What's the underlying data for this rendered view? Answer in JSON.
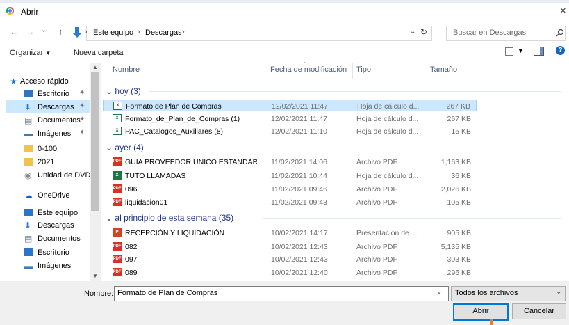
{
  "window": {
    "title": "Abrir",
    "close_glyph": "×"
  },
  "nav": {
    "back": "←",
    "forward": "→",
    "recent": "⌄",
    "up": "↑",
    "breadcrumbs": [
      "Este equipo",
      "Descargas"
    ],
    "search_placeholder": "Buscar en Descargas"
  },
  "toolbar": {
    "organize": "Organizar",
    "new_folder": "Nueva carpeta"
  },
  "sidebar": {
    "items": [
      {
        "label": "Acceso rápido",
        "icon": "star-icon"
      },
      {
        "label": "Escritorio",
        "icon": "desktop-icon",
        "pinned": true
      },
      {
        "label": "Descargas",
        "icon": "download-icon",
        "pinned": true,
        "selected": true
      },
      {
        "label": "Documentos",
        "icon": "document-icon",
        "pinned": true
      },
      {
        "label": "Imágenes",
        "icon": "pictures-icon",
        "pinned": true
      },
      {
        "label": "0-100",
        "icon": "folder-icon"
      },
      {
        "label": "2021",
        "icon": "folder-icon"
      },
      {
        "label": "Unidad de DVD R",
        "icon": "dvd-icon"
      },
      {
        "label": "OneDrive",
        "icon": "cloud-icon"
      },
      {
        "label": "Este equipo",
        "icon": "computer-icon"
      },
      {
        "label": "Descargas",
        "icon": "download-icon"
      },
      {
        "label": "Documentos",
        "icon": "document-icon"
      },
      {
        "label": "Escritorio",
        "icon": "desktop-icon"
      },
      {
        "label": "Imágenes",
        "icon": "pictures-icon"
      }
    ]
  },
  "columns": {
    "name": "Nombre",
    "date": "Fecha de modificación",
    "type": "Tipo",
    "size": "Tamaño"
  },
  "groups": [
    {
      "label": "hoy (3)",
      "files": [
        {
          "name": "Formato de Plan de Compras",
          "date": "12/02/2021 11:47",
          "type": "Hoja de cálculo d...",
          "size": "267 KB",
          "icon": "excel-csv-icon",
          "selected": true
        },
        {
          "name": "Formato_de_Plan_de_Compras (1)",
          "date": "12/02/2021 11:47",
          "type": "Hoja de cálculo d...",
          "size": "267 KB",
          "icon": "excel-csv-icon"
        },
        {
          "name": "PAC_Catalogos_Auxiliares (8)",
          "date": "12/02/2021 11:10",
          "type": "Hoja de cálculo d...",
          "size": "15 KB",
          "icon": "excel-csv-icon"
        }
      ]
    },
    {
      "label": "ayer (4)",
      "files": [
        {
          "name": "GUIA PROVEEDOR UNICO ESTANDARIZA...",
          "date": "11/02/2021 14:06",
          "type": "Archivo PDF",
          "size": "1,163 KB",
          "icon": "pdf-icon"
        },
        {
          "name": "TUTO LLAMADAS",
          "date": "11/02/2021 10:44",
          "type": "Hoja de cálculo d...",
          "size": "36 KB",
          "icon": "excel-icon"
        },
        {
          "name": "096",
          "date": "11/02/2021 09:46",
          "type": "Archivo PDF",
          "size": "2,026 KB",
          "icon": "pdf-icon"
        },
        {
          "name": "liquidacion01",
          "date": "11/02/2021 09:43",
          "type": "Archivo PDF",
          "size": "105 KB",
          "icon": "pdf-icon"
        }
      ]
    },
    {
      "label": "al principio de esta semana (35)",
      "files": [
        {
          "name": "RECEPCIÓN Y LIQUIDACIÓN",
          "date": "10/02/2021 14:17",
          "type": "Presentación de ...",
          "size": "905 KB",
          "icon": "powerpoint-icon"
        },
        {
          "name": "082",
          "date": "10/02/2021 12:43",
          "type": "Archivo PDF",
          "size": "5,135 KB",
          "icon": "pdf-icon"
        },
        {
          "name": "097",
          "date": "10/02/2021 12:43",
          "type": "Archivo PDF",
          "size": "303 KB",
          "icon": "pdf-icon"
        },
        {
          "name": "089",
          "date": "10/02/2021 12:40",
          "type": "Archivo PDF",
          "size": "296 KB",
          "icon": "pdf-icon"
        }
      ]
    }
  ],
  "footer": {
    "filename_label": "Nombre:",
    "filename_value": "Formato de Plan de Compras",
    "filetype_value": "Todos los archivos",
    "open_button": "Abrir",
    "cancel_button": "Cancelar"
  },
  "colors": {
    "selection": "#cce8ff",
    "group_text": "#1e3287",
    "accent": "#0078d7"
  }
}
